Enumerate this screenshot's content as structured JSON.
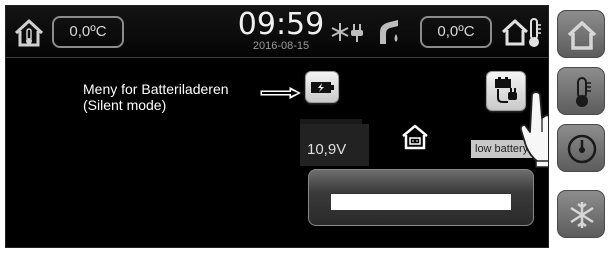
{
  "header": {
    "indoor_temp": "0,0ºC",
    "outdoor_temp": "0,0ºC",
    "time": "09:59",
    "date": "2016-08-15"
  },
  "main": {
    "annotation_line1": "Meny for Batteriladeren",
    "annotation_line2": "(Silent mode)",
    "voltage": "10,9V",
    "status_badge": "low battery",
    "battery_bar_level": 0.0
  },
  "sidebar": {
    "items": [
      {
        "icon": "home-icon",
        "state": "inactive"
      },
      {
        "icon": "thermometer-icon",
        "state": "inactive"
      },
      {
        "icon": "gauge-icon",
        "state": "inactive"
      },
      {
        "icon": "snowflake-icon",
        "state": "inactive"
      }
    ]
  },
  "colors": {
    "background": "#000000",
    "button_face": "#e6e6e6",
    "sidebar_button": "#7a7a7a",
    "text": "#ffffff"
  }
}
